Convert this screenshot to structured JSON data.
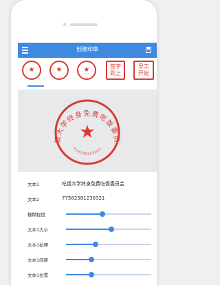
{
  "app": {
    "title": "创建印章"
  },
  "tabs": [
    {
      "text": "★"
    },
    {
      "text": "★"
    },
    {
      "text": "★"
    },
    {
      "text": "签字 到上"
    },
    {
      "text": "早工 开始"
    }
  ],
  "preview": {
    "outer_text": "吃饭大学终身免费吃饭委员会",
    "number_text": "77582581230321",
    "star": "★"
  },
  "form": {
    "rows": [
      {
        "label": "文本1",
        "value": "吃饭大学终身免费吃饭委员会"
      },
      {
        "label": "文本2",
        "value": "77582581230321"
      },
      {
        "label": "模糊程度",
        "level": 0.43
      },
      {
        "label": "文本1大小",
        "level": 0.53
      },
      {
        "label": "文本1拉伸",
        "level": 0.35
      },
      {
        "label": "文本1间距",
        "level": 0.3
      },
      {
        "label": "文本1位置",
        "level": 0.3
      }
    ]
  },
  "colors": {
    "brand": "#3f8ae0",
    "seal": "#d83b35"
  }
}
